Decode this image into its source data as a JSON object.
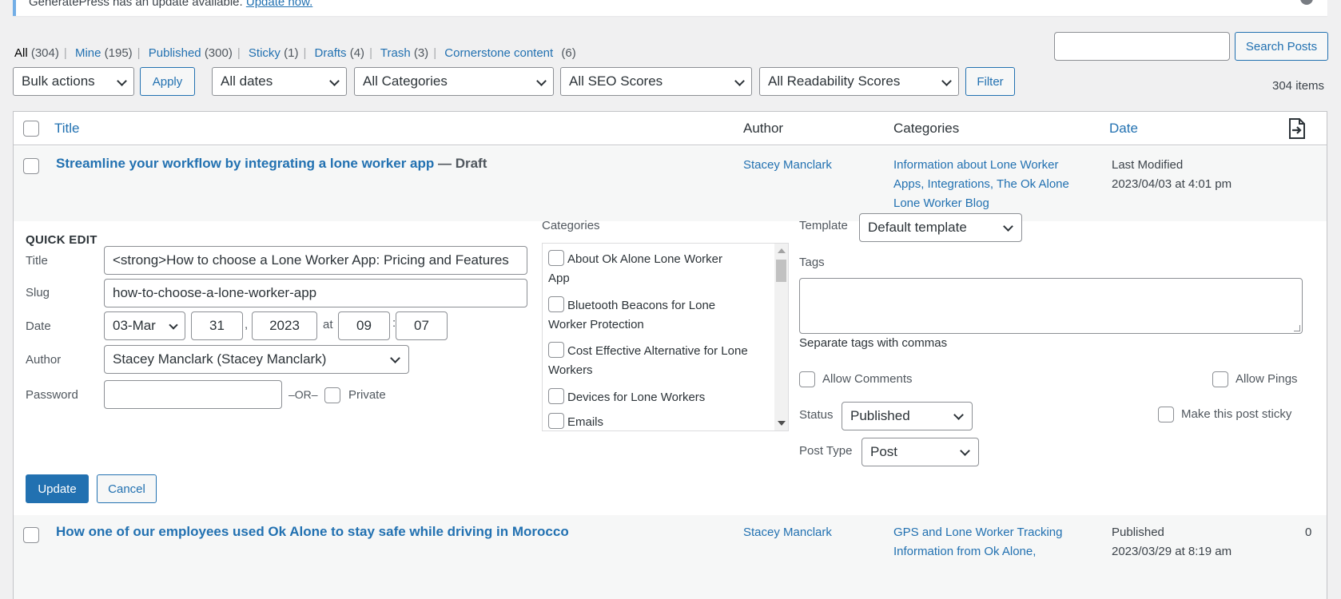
{
  "notice": {
    "text": "GeneratePress has an update available.",
    "link": "Update now."
  },
  "views": [
    {
      "label": "All",
      "count": "(304)",
      "current": true
    },
    {
      "label": "Mine",
      "count": "(195)"
    },
    {
      "label": "Published",
      "count": "(300)"
    },
    {
      "label": "Sticky",
      "count": "(1)"
    },
    {
      "label": "Drafts",
      "count": "(4)"
    },
    {
      "label": "Trash",
      "count": "(3)"
    },
    {
      "label": "Cornerstone content",
      "count": "(6)"
    }
  ],
  "search": {
    "button": "Search Posts",
    "value": ""
  },
  "filters": {
    "bulk": "Bulk actions",
    "apply": "Apply",
    "dates": "All dates",
    "categories": "All Categories",
    "seo": "All SEO Scores",
    "readability": "All Readability Scores",
    "filter": "Filter",
    "items": "304 items"
  },
  "columns": {
    "title": "Title",
    "author": "Author",
    "categories": "Categories",
    "date": "Date"
  },
  "row1": {
    "title": "Streamline your workflow by integrating a lone worker app",
    "state": " — Draft",
    "author": "Stacey Manclark",
    "categories": [
      "Information about Lone Worker",
      "Apps, Integrations, The Ok Alone",
      "Lone Worker Blog"
    ],
    "date_status": "Last Modified",
    "date": "2023/04/03 at 4:01 pm"
  },
  "quick_edit": {
    "heading": "QUICK EDIT",
    "title_label": "Title",
    "title_value": "<strong>How to choose a Lone Worker App: Pricing and Features",
    "slug_label": "Slug",
    "slug_value": "how-to-choose-a-lone-worker-app",
    "date_label": "Date",
    "month": "03-Mar",
    "day": "31",
    "comma": ",",
    "year": "2023",
    "at": "at",
    "hour": "09",
    "colon": ":",
    "minute": "07",
    "author_label": "Author",
    "author_value": "Stacey Manclark (Stacey Manclark)",
    "password_label": "Password",
    "or": "–OR–",
    "private": "Private",
    "categories_label": "Categories",
    "category_list": [
      [
        "About Ok Alone Lone Worker",
        "App"
      ],
      [
        "Bluetooth Beacons for Lone",
        "Worker Protection"
      ],
      [
        "Cost Effective Alternative for Lone",
        "Workers"
      ],
      [
        "Devices for Lone Workers"
      ],
      [
        "Emails"
      ]
    ],
    "template_label": "Template",
    "template_value": "Default template",
    "tags_label": "Tags",
    "tags_hint": "Separate tags with commas",
    "allow_comments": "Allow Comments",
    "allow_pings": "Allow Pings",
    "status_label": "Status",
    "status_value": "Published",
    "sticky": "Make this post sticky",
    "post_type_label": "Post Type",
    "post_type_value": "Post",
    "update": "Update",
    "cancel": "Cancel"
  },
  "row3": {
    "title": "How one of our employees used Ok Alone to stay safe while driving in Morocco",
    "author": "Stacey Manclark",
    "categories": [
      "GPS and Lone Worker Tracking",
      "Information from Ok Alone,"
    ],
    "date_status": "Published",
    "date": "2023/03/29 at 8:19 am",
    "comments": "0"
  }
}
